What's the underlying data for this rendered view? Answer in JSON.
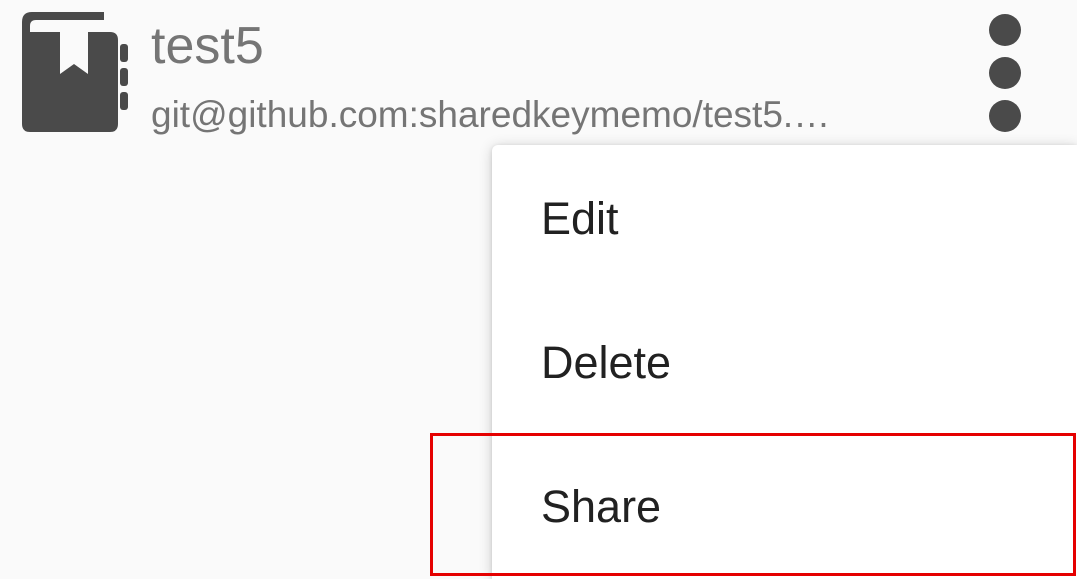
{
  "repository": {
    "title": "test5",
    "url": "git@github.com:sharedkeymemo/test5.…",
    "icon": "repository-book-icon",
    "more_icon": "more-vertical-icon"
  },
  "context_menu": {
    "items": [
      {
        "label": "Edit"
      },
      {
        "label": "Delete"
      },
      {
        "label": "Share"
      }
    ]
  },
  "highlight": {
    "target": "Share",
    "color": "#e50000"
  }
}
